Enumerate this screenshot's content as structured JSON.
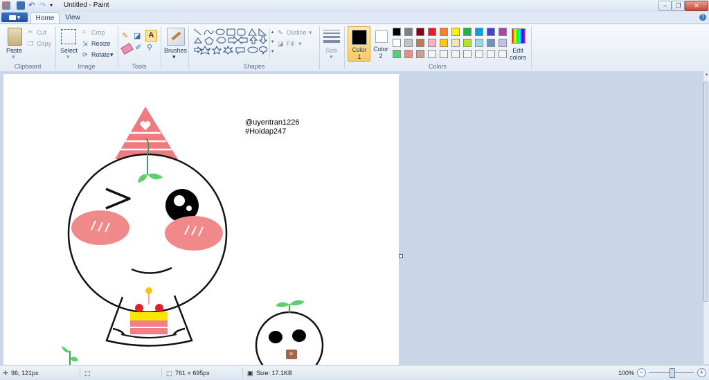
{
  "window": {
    "title": "Untitled - Paint"
  },
  "tabs": {
    "file": "▾",
    "home": "Home",
    "view": "View"
  },
  "clipboard": {
    "paste": "Paste",
    "cut": "Cut",
    "copy": "Copy",
    "group": "Clipboard"
  },
  "image": {
    "select": "Select",
    "crop": "Crop",
    "resize": "Resize",
    "rotate": "Rotate",
    "group": "Image"
  },
  "tools": {
    "group": "Tools"
  },
  "brushes": {
    "label": "Brushes"
  },
  "shapes": {
    "outline": "Outline",
    "fill": "Fill",
    "group": "Shapes"
  },
  "size": {
    "label": "Size"
  },
  "colors": {
    "color1": "Color 1",
    "color2": "Color 2",
    "color1_value": "#000000",
    "color2_value": "#ffffff",
    "edit": "Edit colors",
    "group": "Colors",
    "palette_row1": [
      "#000000",
      "#7f7f7f",
      "#880015",
      "#ed1c24",
      "#ff7f27",
      "#fff200",
      "#22b14c",
      "#00a2e8",
      "#3f48cc",
      "#a349a4"
    ],
    "palette_row2": [
      "#ffffff",
      "#c3c3c3",
      "#b97a57",
      "#ffaec9",
      "#ffc90e",
      "#efe4b0",
      "#b5e61d",
      "#99d9ea",
      "#7092be",
      "#c8bfe7"
    ],
    "palette_row3": [
      "#4dd27a",
      "#f08a8a",
      "#c9a38a",
      "#f4f4f4",
      "#f4f4f4",
      "#f4f4f4",
      "#f4f4f4",
      "#f4f4f4",
      "#f4f4f4",
      "#f4f4f4"
    ]
  },
  "canvas": {
    "caption_line1": "@uyentran1226",
    "caption_line2": "#Hoidap247"
  },
  "status": {
    "cursor": "96, 121px",
    "dimensions": "761 × 695px",
    "size": "Size: 17.1KB",
    "zoom": "100%"
  }
}
